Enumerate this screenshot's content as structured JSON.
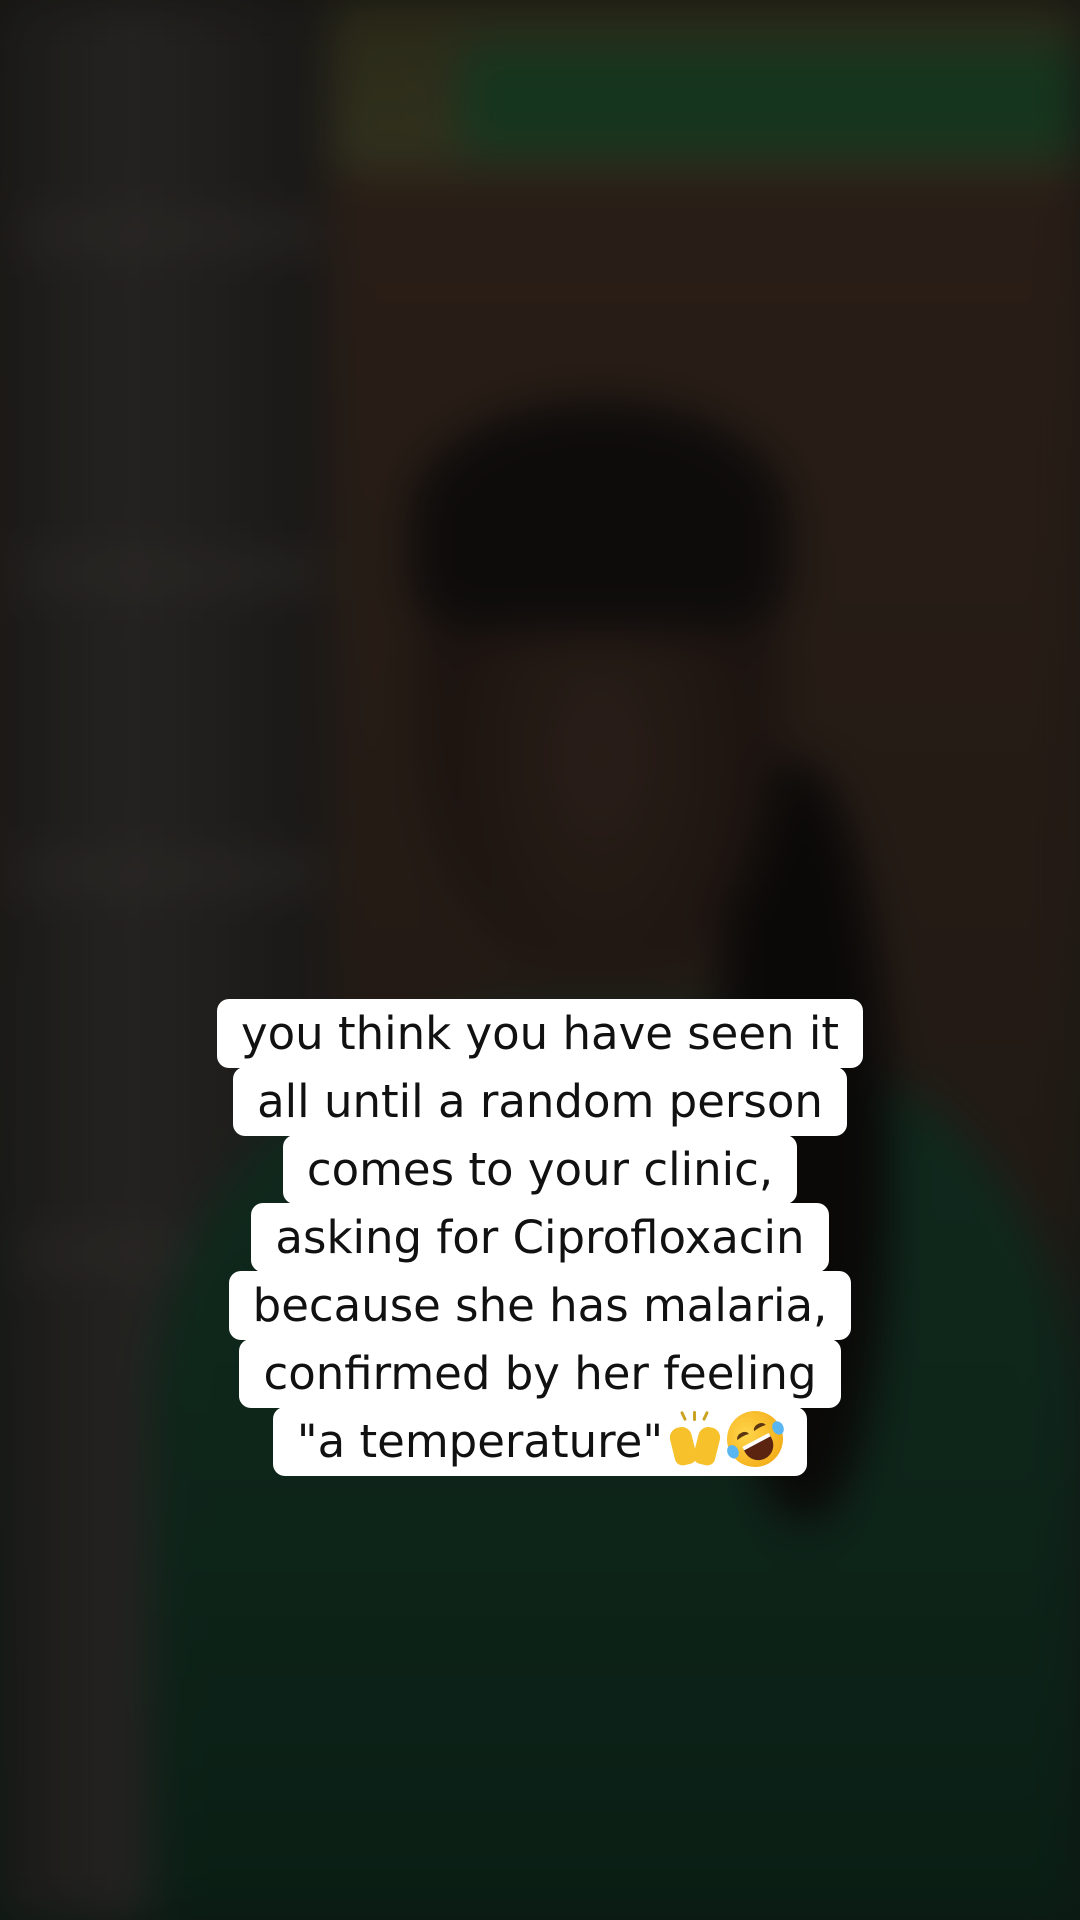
{
  "caption": {
    "lines": [
      "you think you have seen it",
      "all until a random person",
      "comes to your clinic,",
      "asking for Ciprofloxacin",
      "because she has malaria,",
      "confirmed by her feeling",
      "\"a temperature\""
    ],
    "emoji": [
      "raised-hands-icon",
      "rolling-on-floor-laughing-icon"
    ]
  },
  "colors": {
    "caption_background": "#ffffff",
    "caption_text": "#111111",
    "shirt": "#143424",
    "background": "#2b221d"
  }
}
